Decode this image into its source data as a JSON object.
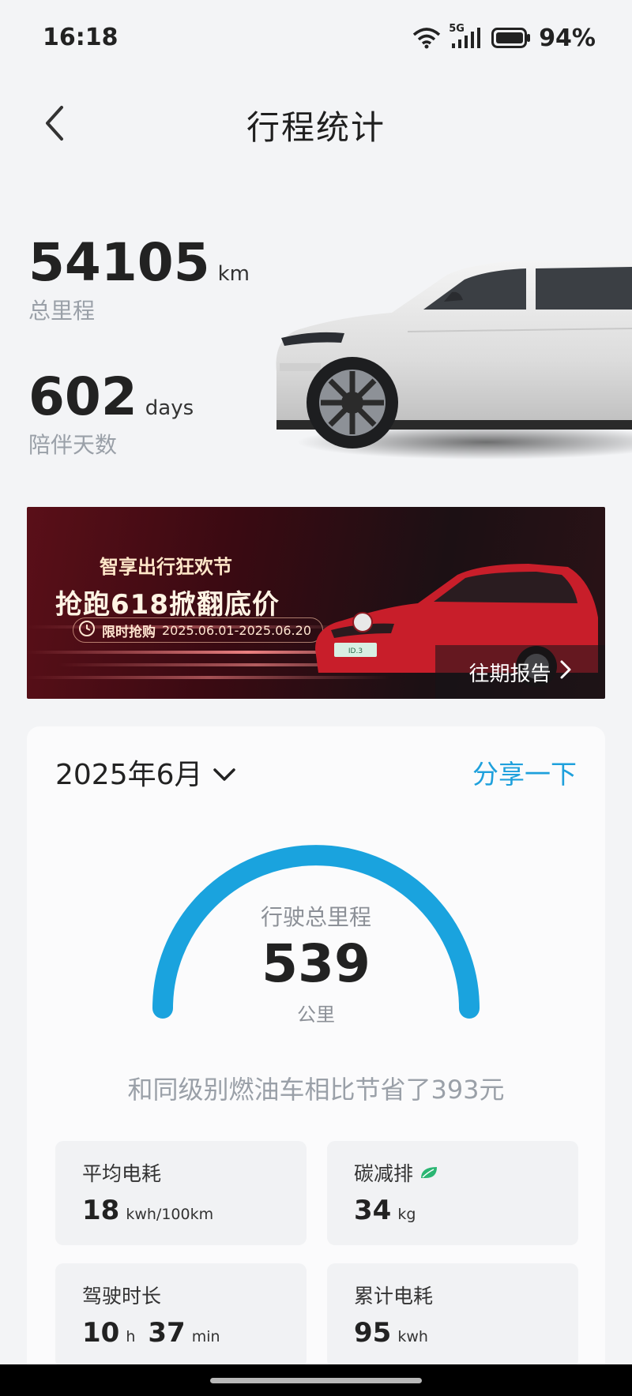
{
  "status": {
    "time": "16:18",
    "network": "5G",
    "battery": "94%"
  },
  "header": {
    "title": "行程统计"
  },
  "summary": {
    "total_mileage": "54105",
    "total_mileage_unit": "km",
    "total_mileage_label": "总里程",
    "days": "602",
    "days_unit": "days",
    "days_label": "陪伴天数"
  },
  "banner": {
    "title1": "智享出行狂欢节",
    "title2": "抢跑618掀翻底价",
    "tag": "限时抢购",
    "dates": "2025.06.01-2025.06.20",
    "plate": "ID.3",
    "history_label": "往期报告"
  },
  "report": {
    "month": "2025年6月",
    "share_label": "分享一下",
    "gauge_label": "行驶总里程",
    "gauge_value": "539",
    "gauge_unit": "公里",
    "gauge_fill_fraction": 1.0,
    "saving_text": "和同级别燃油车相比节省了393元",
    "tiles": [
      {
        "label": "平均电耗",
        "value": "18",
        "unit": "kwh/100km"
      },
      {
        "label": "碳减排",
        "value": "34",
        "unit": "kg"
      },
      {
        "label": "驾驶时长",
        "hours": "10",
        "hours_unit": "h",
        "minutes": "37",
        "minutes_unit": "min"
      },
      {
        "label": "累计电耗",
        "value": "95",
        "unit": "kwh"
      }
    ]
  },
  "colors": {
    "accent": "#1ea0dc",
    "gauge": "#1aa3de",
    "leaf": "#2bb673"
  }
}
